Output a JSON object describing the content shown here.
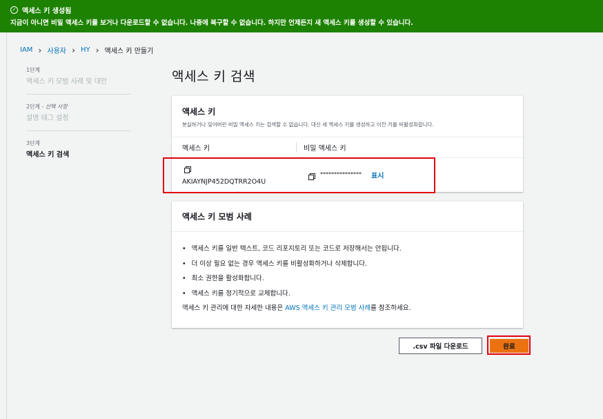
{
  "banner": {
    "title": "액세스 키 생성됨",
    "message": "지금이 아니면 비밀 액세스 키를 보거나 다운로드할 수 없습니다. 나중에 복구할 수 없습니다. 하지만 언제든지 새 액세스 키를 생성할 수 있습니다."
  },
  "breadcrumb": {
    "items": [
      "IAM",
      "사용자",
      "HY"
    ],
    "current": "액세스 키 만들기"
  },
  "steps": [
    {
      "num": "1단계",
      "name": "액세스 키 모범 사례 및 대안"
    },
    {
      "num": "2단계",
      "optional": "선택 사항",
      "name": "설명 태그 설정"
    },
    {
      "num": "3단계",
      "name": "액세스 키 검색"
    }
  ],
  "page_title": "액세스 키 검색",
  "access_key_card": {
    "heading": "액세스 키",
    "description": "분실하거나 잊어버린 비밀 액세스 키는 검색할 수 없습니다. 대신 새 액세스 키를 생성하고 이전 키를 비활성화합니다.",
    "col_access_key": "액세스 키",
    "col_secret_key": "비밀 액세스 키",
    "access_key_value": "AKIAYNJP452DQTRR2O4U",
    "secret_key_mask": "***************",
    "show_label": "표시"
  },
  "best_practices_card": {
    "heading": "액세스 키 모범 사례",
    "items": [
      "액세스 키를 일반 텍스트, 코드 리포지토리 또는 코드로 저장해서는 안됩니다.",
      "더 이상 필요 없는 경우 액세스 키를 비활성화하거나 삭제합니다.",
      "최소 권한을 활성화합니다.",
      "액세스 키를 정기적으로 교체합니다."
    ],
    "footer_prefix": "액세스 키 관리에 대한 자세한 내용은 ",
    "footer_link": "AWS 액세스 키 관리 모범 사례",
    "footer_suffix": "를 참조하세요."
  },
  "buttons": {
    "csv": ".csv 파일 다운로드",
    "done": "완료"
  },
  "colors": {
    "banner": "#1d8102",
    "link": "#0073bb",
    "primary_button": "#ec7211",
    "highlight": "#e3000f"
  }
}
